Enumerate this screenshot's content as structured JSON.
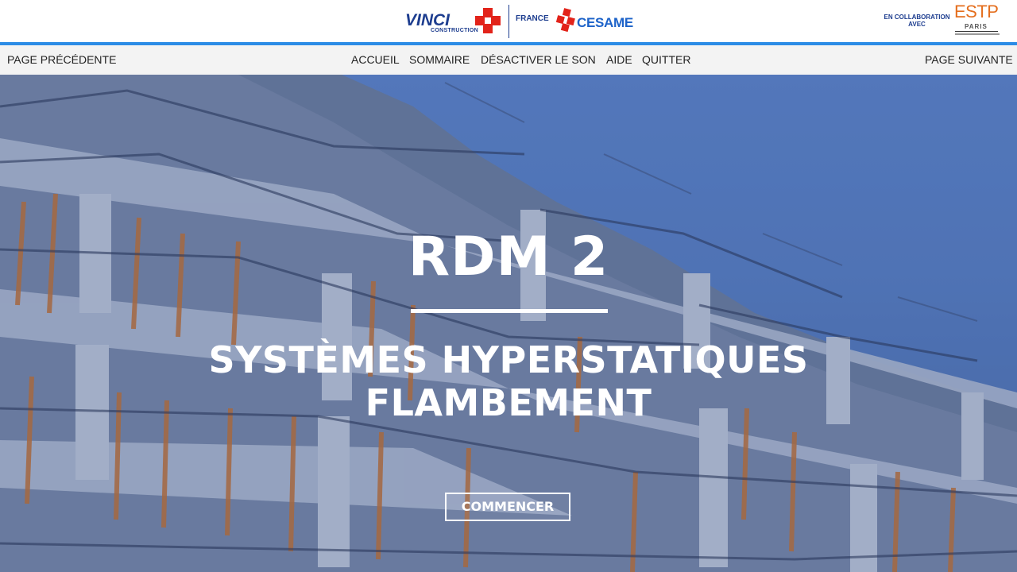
{
  "header": {
    "vinci_logo": {
      "name": "VINCI",
      "sub": "CONSTRUCTION",
      "mark_colors": [
        "#e2231a"
      ],
      "text_color": "#1d3d8f"
    },
    "country": "FRANCE",
    "cesame_logo": {
      "name": "CESAME",
      "text_color": "#1d63c9",
      "mark_color": "#e2231a"
    },
    "collaboration": {
      "line1": "EN COLLABORATION",
      "line2": "AVEC"
    },
    "estp_logo": {
      "name": "ESTP",
      "sub": "PARIS",
      "color": "#e46e1d"
    },
    "accent_color": "#2b8ce6"
  },
  "nav": {
    "previous": "PAGE PRÉCÉDENTE",
    "home": "ACCUEIL",
    "summary": "SOMMAIRE",
    "mute": "DÉSACTIVER LE SON",
    "help": "AIDE",
    "quit": "QUITTER",
    "next": "PAGE SUIVANTE"
  },
  "hero": {
    "title": "RDM 2",
    "subtitle_line1": "SYSTÈMES HYPERSTATIQUES",
    "subtitle_line2": "FLAMBEMENT",
    "start_button": "COMMENCER",
    "background": "construction-site-scaffolding"
  }
}
